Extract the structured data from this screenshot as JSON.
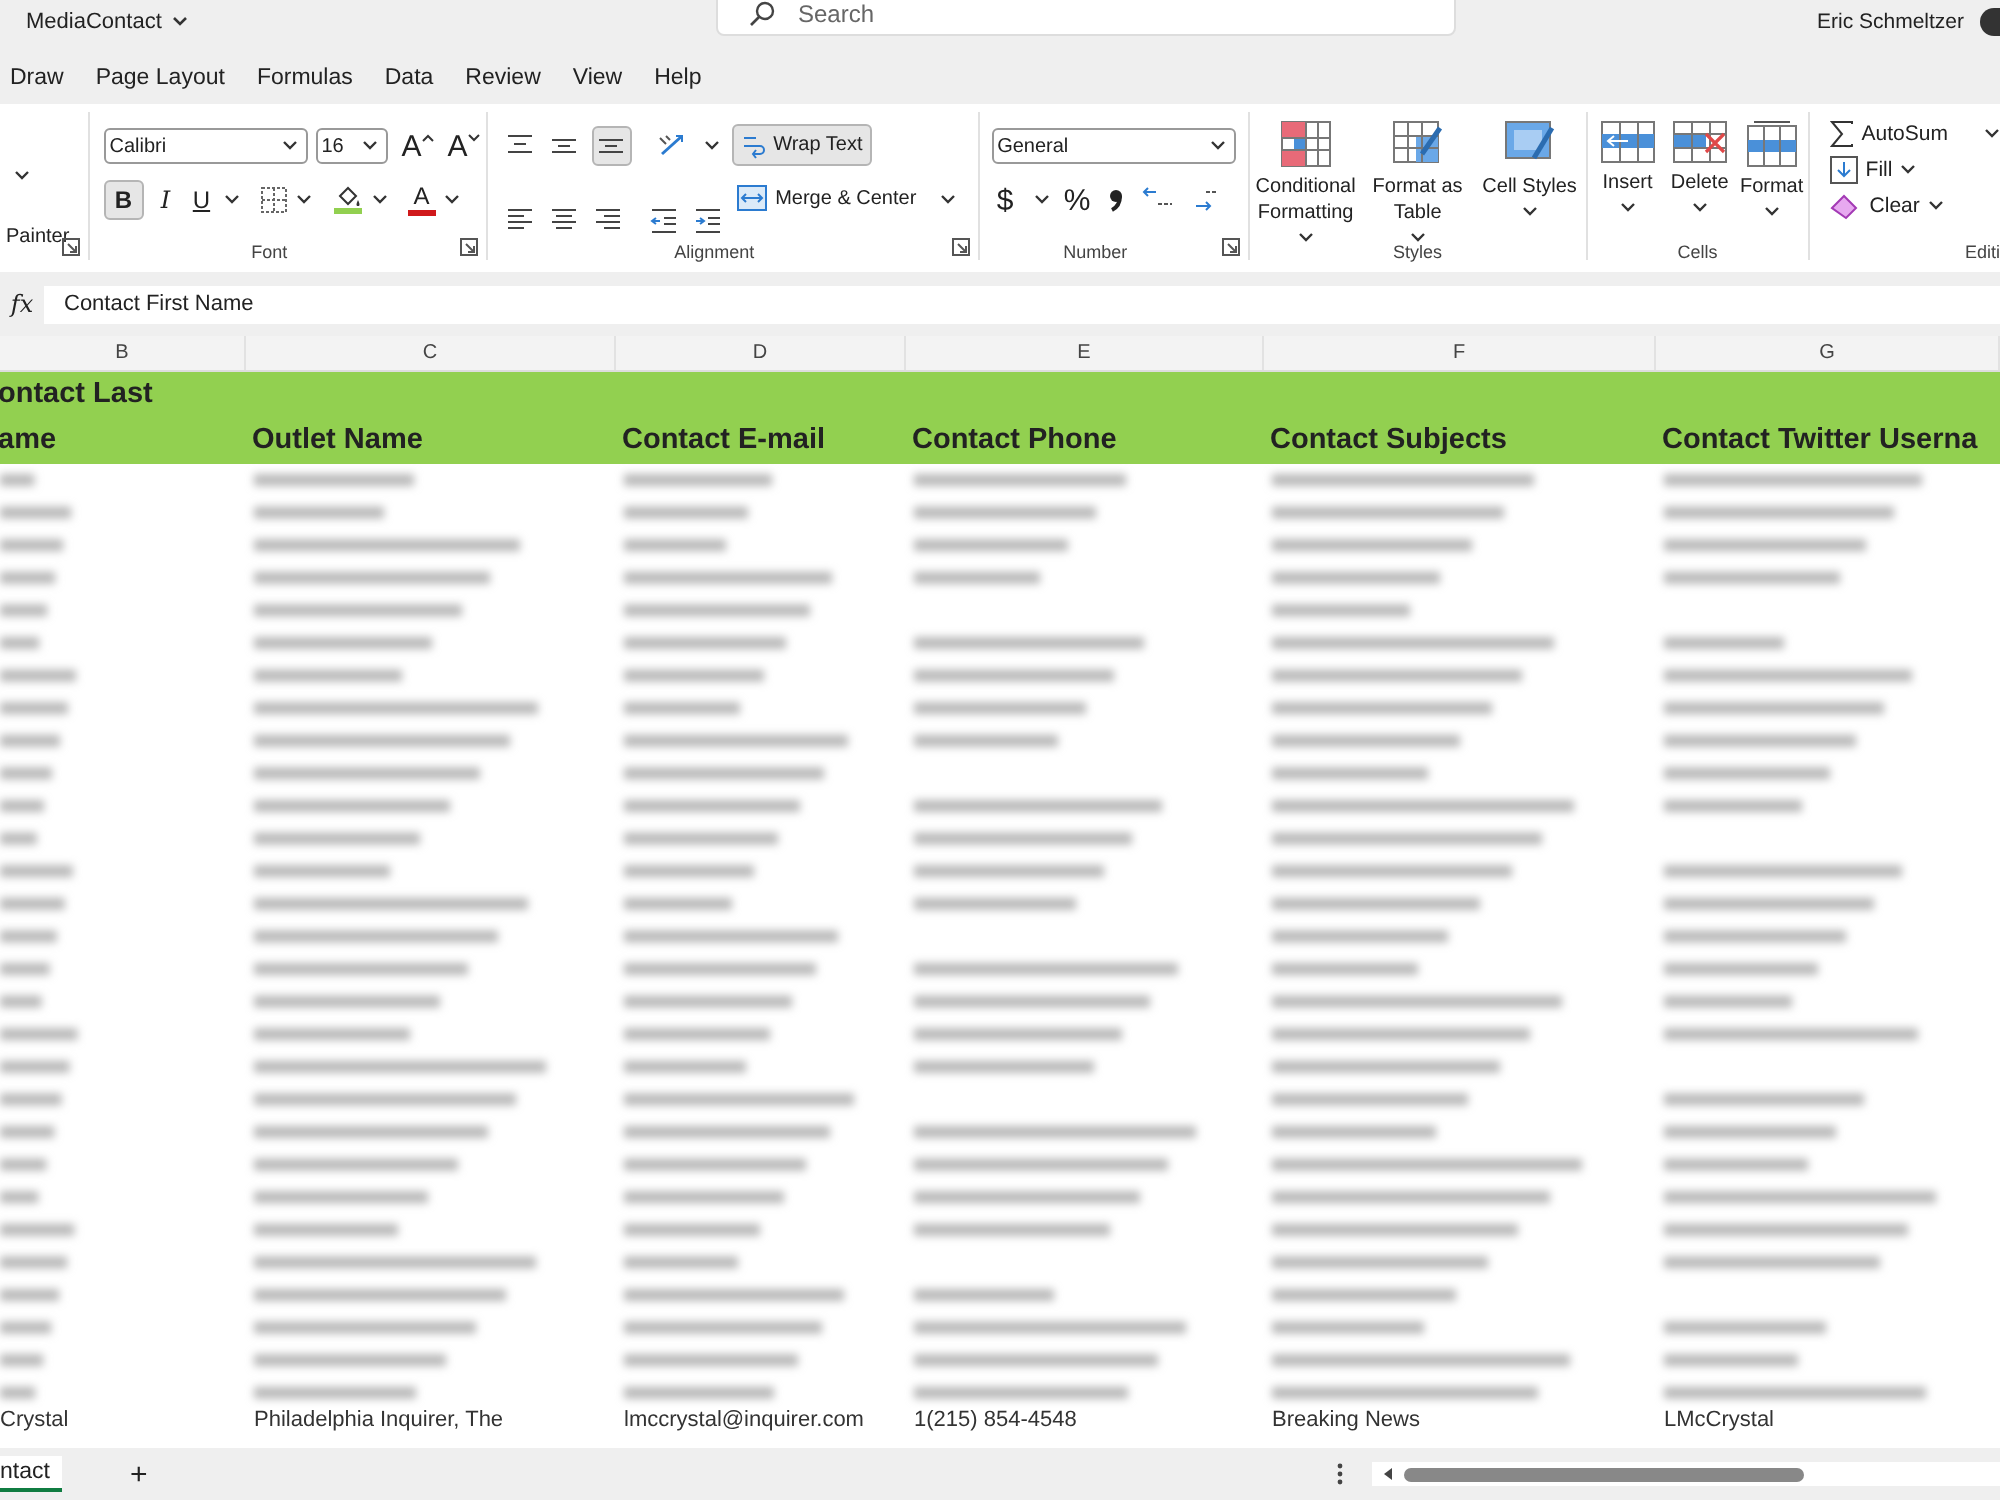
{
  "titlebar": {
    "workbook": "MediaContact",
    "search": {
      "placeholder": "Search"
    },
    "user": "Eric Schmeltzer"
  },
  "tabs": [
    {
      "label": "Draw",
      "selected": false
    },
    {
      "label": "Page Layout",
      "selected": false
    },
    {
      "label": "Formulas",
      "selected": false
    },
    {
      "label": "Data",
      "selected": false
    },
    {
      "label": "Review",
      "selected": false
    },
    {
      "label": "View",
      "selected": false
    },
    {
      "label": "Help",
      "selected": false
    }
  ],
  "ribbon": {
    "clipboard": {
      "painter": "Painter"
    },
    "font": {
      "label": "Font",
      "family": "Calibri",
      "size": "16",
      "grow": "A",
      "shrink": "A",
      "bold": {
        "label": "B",
        "selected": true
      },
      "italic": "I",
      "underline": "U",
      "font_color": "A"
    },
    "alignment": {
      "label": "Alignment",
      "bottom_align_selected": true,
      "wrap_text": {
        "label": "Wrap Text",
        "selected": true
      },
      "merge": "Merge & Center"
    },
    "number": {
      "label": "Number",
      "format": "General",
      "currency": "$",
      "percent": "%"
    },
    "styles": {
      "label": "Styles",
      "buttons": [
        "Conditional Formatting",
        "Format as Table",
        "Cell Styles"
      ]
    },
    "cells": {
      "label": "Cells",
      "buttons": [
        "Insert",
        "Delete",
        "Format"
      ]
    },
    "editing": {
      "label": "Editi",
      "autosum": "AutoSum",
      "fill": "Fill",
      "clear": "Clear"
    }
  },
  "formula_bar": {
    "fx": "fx",
    "value": "Contact First Name"
  },
  "sheet": {
    "columns": [
      "B",
      "C",
      "D",
      "E",
      "F",
      "G"
    ],
    "header": [
      [
        "ontact Last",
        "ame"
      ],
      [
        "Outlet Name"
      ],
      [
        "Contact E-mail"
      ],
      [
        "Contact Phone"
      ],
      [
        "Contact Subjects"
      ],
      [
        "Contact Twitter Userna"
      ]
    ],
    "last_row": [
      "Crystal",
      "Philadelphia Inquirer, The",
      "lmccrystal@inquirer.com",
      "1(215) 854-4548",
      "Breaking News",
      "LMcCrystal"
    ]
  },
  "sheet_tabs": [
    {
      "label": "ntact",
      "selected": true
    }
  ],
  "add_sheet": "+"
}
